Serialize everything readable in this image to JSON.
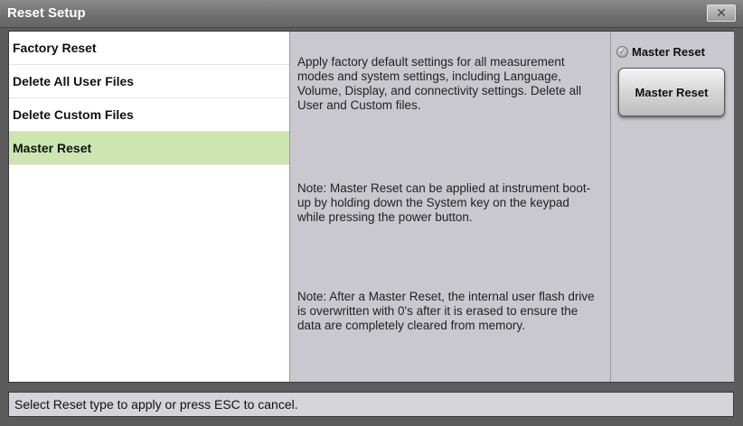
{
  "window": {
    "title": "Reset Setup",
    "close_glyph": "✕"
  },
  "list": {
    "items": [
      {
        "label": "Factory Reset",
        "selected": false
      },
      {
        "label": "Delete All User Files",
        "selected": false
      },
      {
        "label": "Delete Custom Files",
        "selected": false
      },
      {
        "label": "Master Reset",
        "selected": true
      }
    ]
  },
  "description": {
    "para1": "Apply factory default settings for all measurement modes and system settings, including Language, Volume, Display, and connectivity settings. Delete all User and Custom files.",
    "para2": "Note: Master Reset can be applied at instrument boot-up by holding down the System key on the keypad while pressing the power button.",
    "para3": "Note: After a Master Reset, the internal user flash drive is overwritten with 0's after it is erased to ensure the data are completely cleared from memory."
  },
  "right_panel": {
    "radio_label": "Master Reset",
    "radio_checked": true,
    "button_label": "Master Reset"
  },
  "status_bar": {
    "text": "Select Reset type to apply or press ESC to cancel."
  },
  "colors": {
    "selected_item": "#cde6b1",
    "panel_bg": "#c9c8cf",
    "frame_bg": "#5c5c5c"
  }
}
